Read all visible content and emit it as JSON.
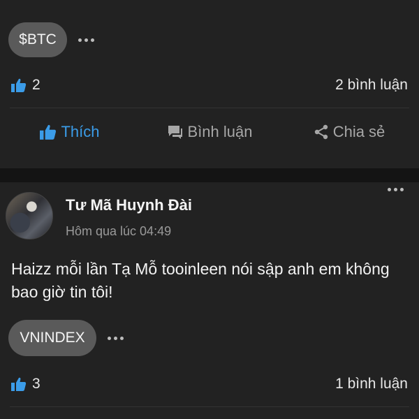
{
  "post1": {
    "tag": "$BTC",
    "likes": "2",
    "comments": "2 bình luận"
  },
  "actions": {
    "like": "Thích",
    "comment": "Bình luận",
    "share": "Chia sẻ"
  },
  "post2": {
    "author": "Tư Mã Huynh Đài",
    "time": "Hôm qua lúc 04:49",
    "content": "Haizz mỗi lần Tạ Mỗ tooinleen nói sập anh em không bao giờ tin tôi!",
    "tag": "VNINDEX",
    "likes": "3",
    "comments": "1 bình luận"
  },
  "colors": {
    "accent": "#3b9ce8",
    "background": "#222222",
    "tag_bg": "#5a5a5a"
  },
  "icons": [
    "thumbs-up-icon",
    "comment-icon",
    "share-icon",
    "more-icon"
  ]
}
